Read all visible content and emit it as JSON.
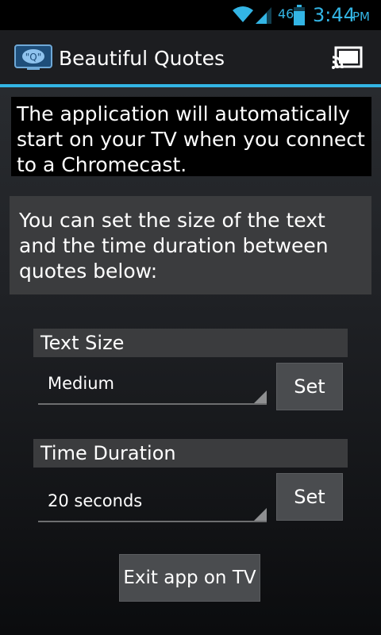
{
  "status_bar": {
    "network_label": "46",
    "time": "3:44",
    "ampm": "PM",
    "accent_color": "#33b5e5",
    "icons": [
      "wifi-icon",
      "cell-signal-icon",
      "battery-icon"
    ]
  },
  "action_bar": {
    "title": "Beautiful Quotes",
    "app_icon": "tv-quote-icon",
    "cast_icon": "cast-icon",
    "divider_color": "#33b5e5"
  },
  "info": {
    "chromecast_text": "The application will automatically start on your TV when you connect to a Chromecast.",
    "settings_text": "You can set the size of the text and the time duration between quotes below:"
  },
  "text_size": {
    "header": "Text Size",
    "selected": "Medium",
    "set_label": "Set"
  },
  "time_duration": {
    "header": "Time Duration",
    "selected": "20 seconds",
    "set_label": "Set"
  },
  "exit_label": "Exit app on TV"
}
